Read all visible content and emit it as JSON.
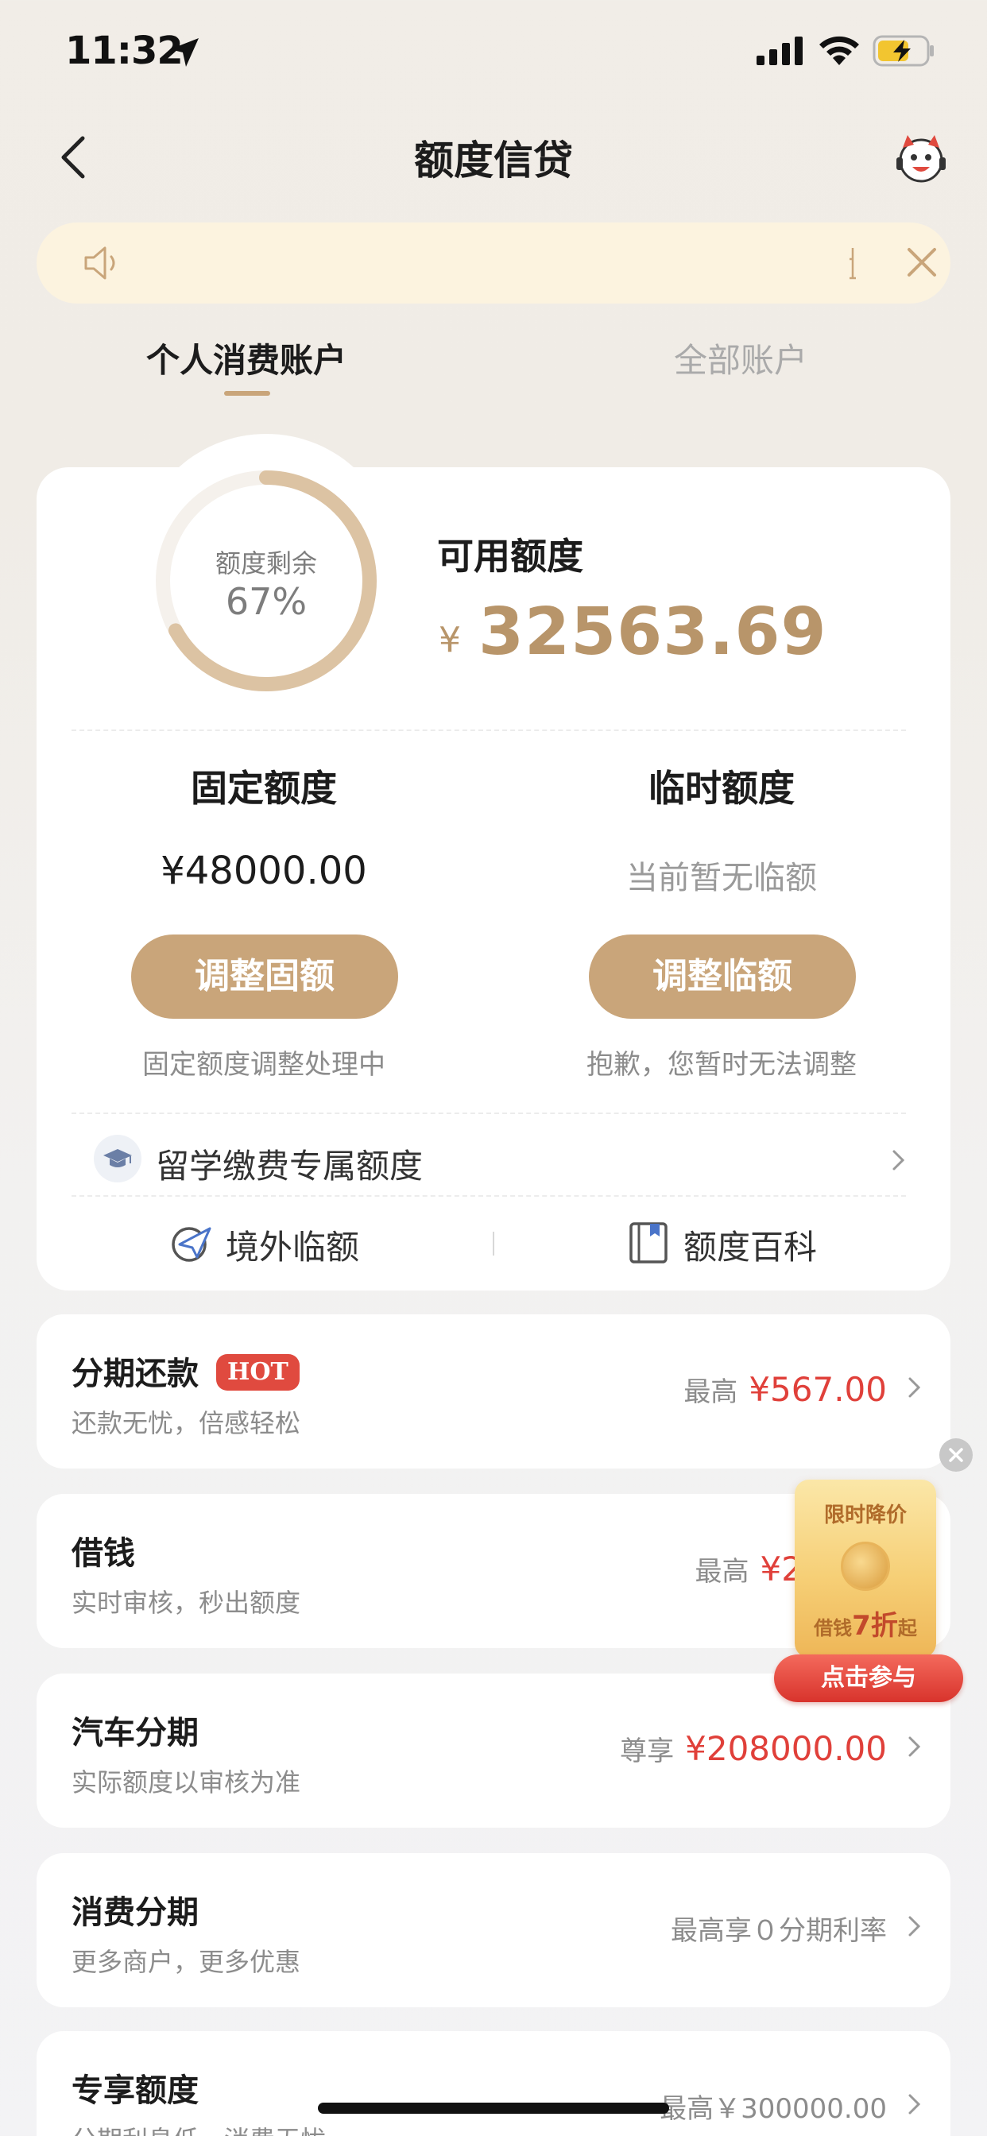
{
  "status": {
    "time": "11:32"
  },
  "nav": {
    "title": "额度信贷"
  },
  "tabs": [
    {
      "label": "个人消费账户",
      "active": true
    },
    {
      "label": "全部账户",
      "active": false
    }
  ],
  "summary": {
    "remaining_label": "额度剩余",
    "remaining_pct": "67%",
    "remaining_fraction": 0.67,
    "available_label": "可用额度",
    "currency": "¥",
    "available_amount": "32563.69"
  },
  "fixed": {
    "title": "固定额度",
    "value": "¥48000.00",
    "button": "调整固额",
    "note": "固定额度调整处理中"
  },
  "temp": {
    "title": "临时额度",
    "value": "当前暂无临额",
    "button": "调整临额",
    "note": "抱歉，您暂时无法调整"
  },
  "study": {
    "label": "留学缴费专属额度"
  },
  "links": {
    "overseas": "境外临额",
    "wiki": "额度百科"
  },
  "list": [
    {
      "title": "分期还款",
      "badge": "HOT",
      "subtitle": "还款无忧，倍感轻松",
      "prefix": "最高",
      "amount": "¥567.00"
    },
    {
      "title": "借钱",
      "subtitle": "实时审核，秒出额度",
      "prefix": "最高",
      "amount": "¥2"
    },
    {
      "title": "汽车分期",
      "subtitle": "实际额度以审核为准",
      "prefix": "尊享",
      "amount": "¥208000.00"
    },
    {
      "title": "消费分期",
      "subtitle": "更多商户，更多优惠",
      "prefix": "最高享０分期利率",
      "amount": ""
    },
    {
      "title": "专享额度",
      "subtitle": "分期利息低，消费无忧",
      "prefix": "最高￥300000.00",
      "amount": ""
    }
  ],
  "promo": {
    "top": "限时降价",
    "mid_prefix": "借钱",
    "mid_big": "7折",
    "mid_suffix": "起",
    "button": "点击参与"
  },
  "colors": {
    "accent": "#c9a57a",
    "gold_text": "#b8956a",
    "red": "#e0403a",
    "notice_bg": "#fcf3df"
  }
}
